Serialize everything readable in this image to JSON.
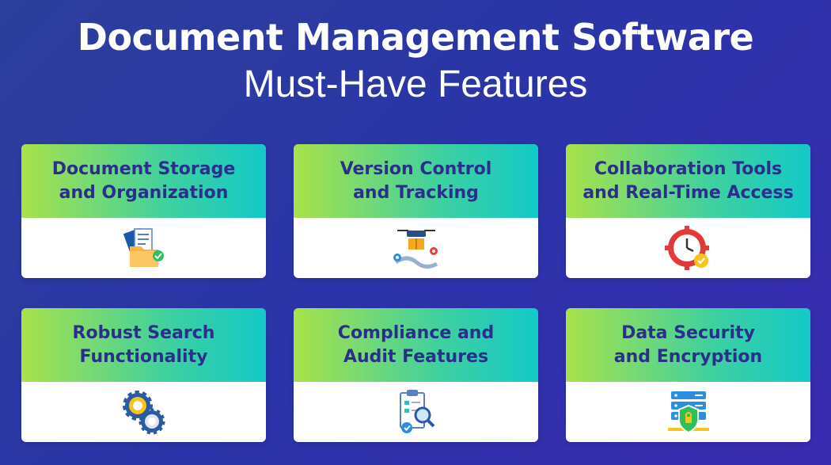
{
  "header": {
    "title": "Document Management Software",
    "subtitle": "Must-Have Features"
  },
  "cards": [
    {
      "title_line1": "Document Storage",
      "title_line2": "and Organization",
      "icon": "folder-documents-icon"
    },
    {
      "title_line1": "Version Control",
      "title_line2": "and Tracking",
      "icon": "drone-delivery-icon"
    },
    {
      "title_line1": "Collaboration Tools",
      "title_line2": "and Real-Time Access",
      "icon": "clock-gear-icon"
    },
    {
      "title_line1": "Robust Search",
      "title_line2": "Functionality",
      "icon": "gears-search-icon"
    },
    {
      "title_line1": "Compliance and",
      "title_line2": "Audit Features",
      "icon": "clipboard-magnifier-icon"
    },
    {
      "title_line1": "Data Security",
      "title_line2": "and Encryption",
      "icon": "server-shield-icon"
    }
  ]
}
